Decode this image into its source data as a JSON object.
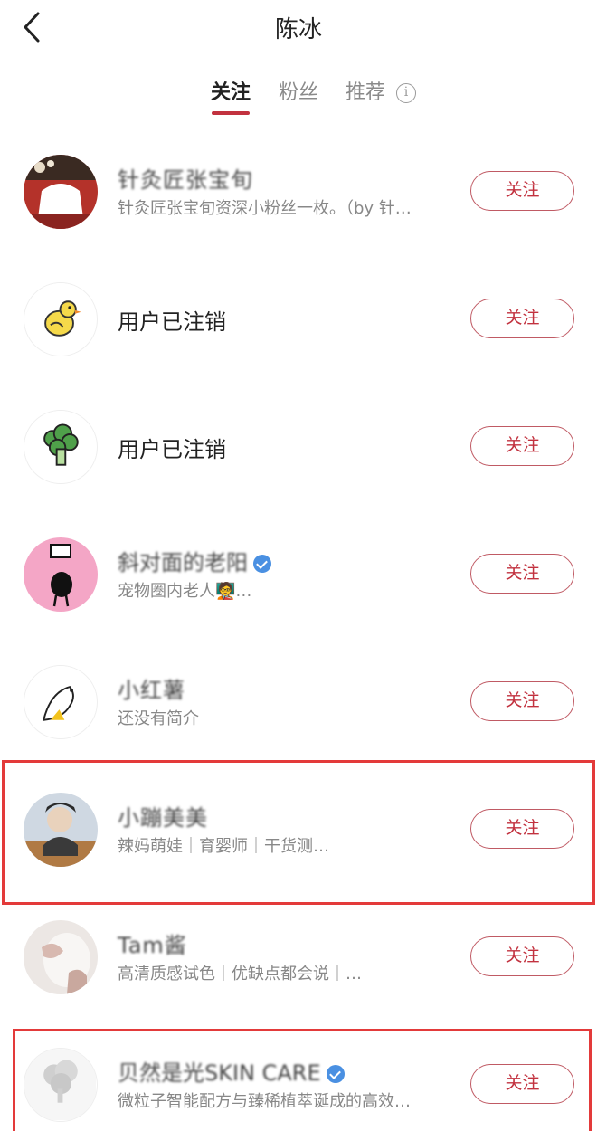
{
  "header": {
    "title": "陈冰"
  },
  "tabs": [
    {
      "label": "关注",
      "active": true
    },
    {
      "label": "粉丝",
      "active": false
    },
    {
      "label": "推荐",
      "active": false
    }
  ],
  "follow_label": "关注",
  "accent_color": "#c2323f",
  "highlight_color": "#e33a3a",
  "users": [
    {
      "name": "针灸匠张宝旬",
      "bio": "针灸匠张宝旬资深小粉丝一枚。（by 针…",
      "verified": false,
      "obscured": true
    },
    {
      "name": "用户已注销",
      "bio": "",
      "verified": false,
      "obscured": false
    },
    {
      "name": "用户已注销",
      "bio": "",
      "verified": false,
      "obscured": false
    },
    {
      "name": "斜对面的老阳",
      "bio": "宠物圈内老人🧑‍🏫…",
      "verified": true,
      "obscured": true
    },
    {
      "name": "小红薯",
      "bio": "还没有简介",
      "verified": false,
      "obscured": true
    },
    {
      "name": "小蹦美美",
      "bio": "辣妈萌娃｜育婴师｜干货测…",
      "verified": false,
      "obscured": true
    },
    {
      "name": "Tam酱",
      "bio": "高清质感试色｜优缺点都会说｜…",
      "verified": false,
      "obscured": true
    },
    {
      "name": "贝然是光SKIN CARE",
      "bio": "微粒子智能配方与臻稀植萃诞成的高效…",
      "verified": true,
      "obscured": true
    }
  ]
}
